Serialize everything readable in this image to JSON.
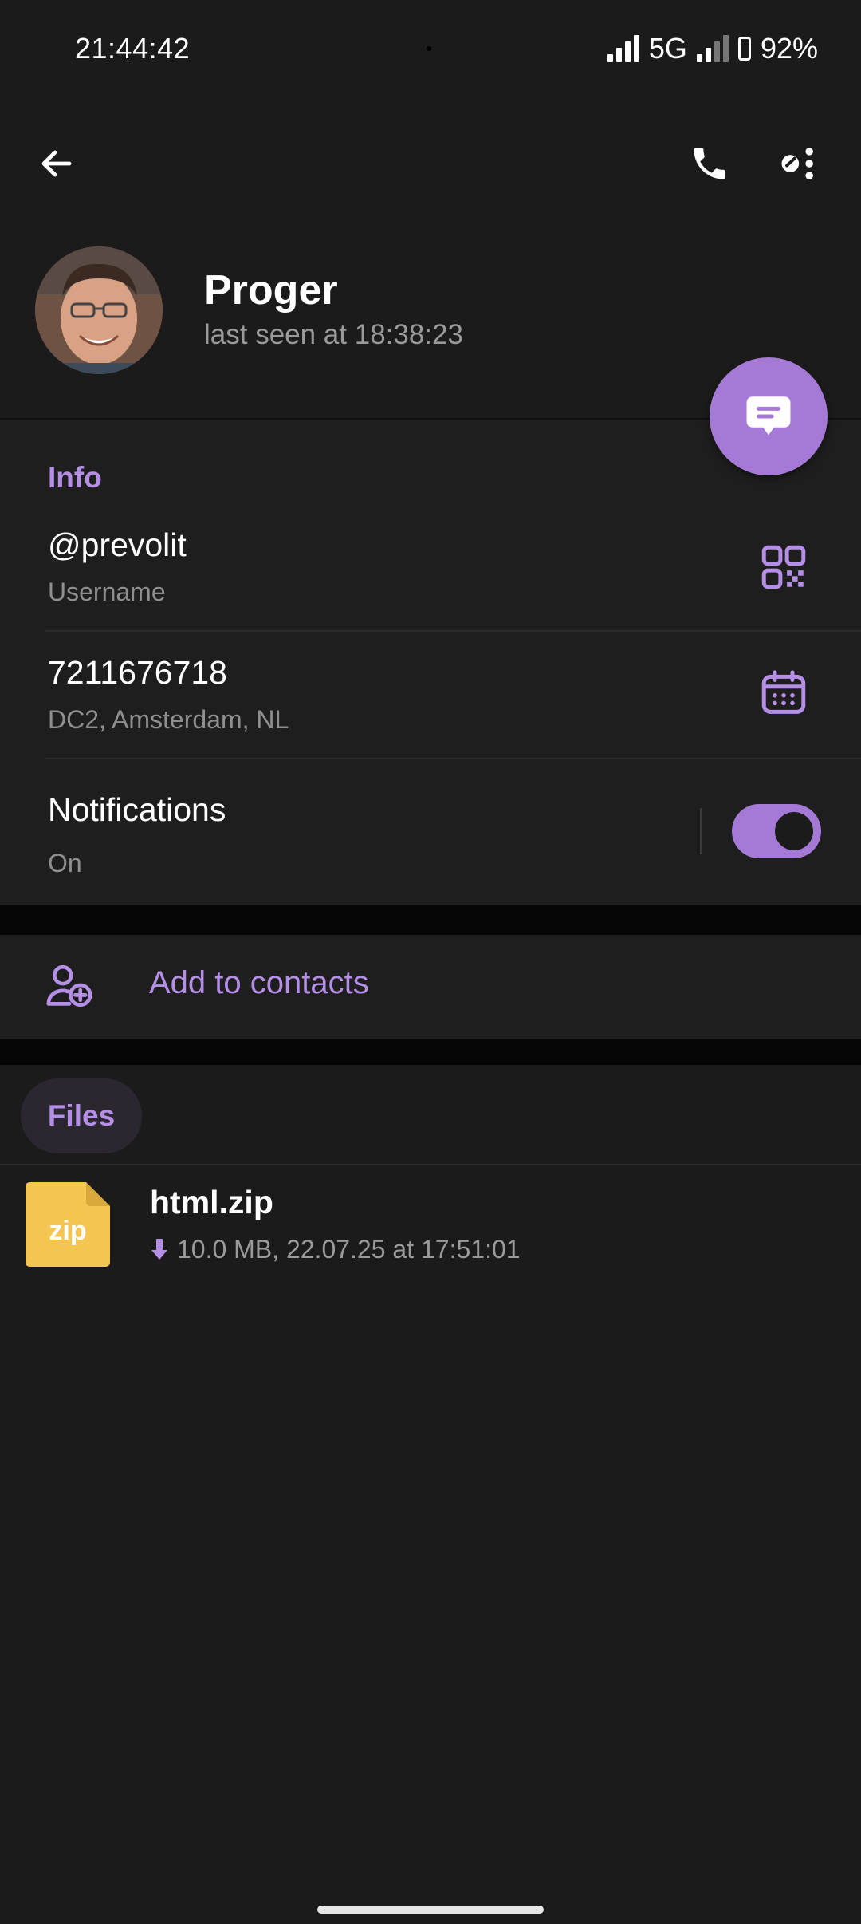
{
  "status_bar": {
    "time": "21:44:42",
    "network": "5G",
    "battery": "92%"
  },
  "profile": {
    "name": "Proger",
    "last_seen": "last seen at 18:38:23"
  },
  "info": {
    "section_title": "Info",
    "username_value": "@prevolit",
    "username_label": "Username",
    "id_value": "7211676718",
    "id_label": "DC2, Amsterdam, NL",
    "notifications_label": "Notifications",
    "notifications_state": "On",
    "notifications_enabled": true
  },
  "actions": {
    "add_contact": "Add to contacts"
  },
  "files": {
    "tab_label": "Files",
    "items": [
      {
        "icon_text": "zip",
        "name": "html.zip",
        "meta": "10.0 MB, 22.07.25 at 17:51:01"
      }
    ]
  },
  "colors": {
    "accent": "#b58ee6",
    "fab": "#a57ad6",
    "zip_icon": "#f4c550",
    "background": "#1b1b1b"
  },
  "icons": {
    "back": "arrow-left-icon",
    "call": "phone-icon",
    "more": "more-options-icon",
    "fab": "message-icon",
    "qr": "qr-code-icon",
    "calendar": "calendar-icon",
    "add_contact": "add-contact-icon",
    "download": "download-arrow-icon"
  }
}
